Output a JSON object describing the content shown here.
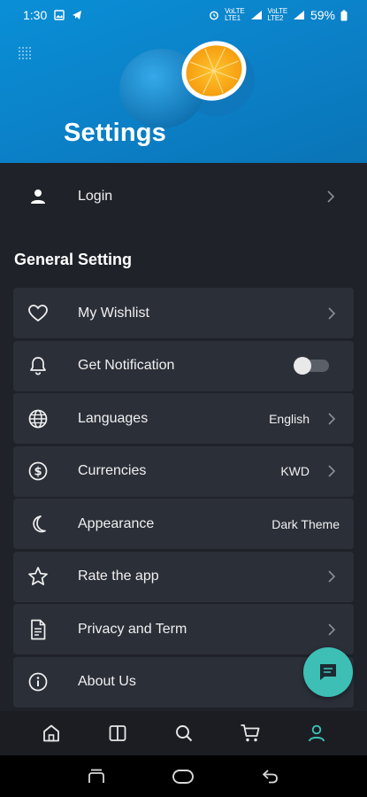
{
  "status_bar": {
    "time": "1:30",
    "battery": "59%"
  },
  "header": {
    "title": "Settings"
  },
  "login": {
    "label": "Login"
  },
  "general": {
    "title": "General Setting",
    "items": [
      {
        "label": "My Wishlist",
        "value": "",
        "icon": "heart-icon",
        "trailing": "chevron"
      },
      {
        "label": "Get Notification",
        "value": "",
        "icon": "bell-icon",
        "trailing": "toggle",
        "toggle_on": false
      },
      {
        "label": "Languages",
        "value": "English",
        "icon": "globe-icon",
        "trailing": "chevron"
      },
      {
        "label": "Currencies",
        "value": "KWD",
        "icon": "dollar-circle-icon",
        "trailing": "chevron"
      },
      {
        "label": "Appearance",
        "value": "Dark Theme",
        "icon": "moon-icon",
        "trailing": "none"
      },
      {
        "label": "Rate the app",
        "value": "",
        "icon": "star-icon",
        "trailing": "chevron"
      },
      {
        "label": "Privacy and Term",
        "value": "",
        "icon": "document-icon",
        "trailing": "chevron"
      },
      {
        "label": "About Us",
        "value": "",
        "icon": "info-icon",
        "trailing": "none"
      }
    ]
  },
  "bottom_nav": {
    "items": [
      "home-icon",
      "book-icon",
      "search-icon",
      "cart-icon",
      "profile-icon"
    ],
    "active": "profile-icon",
    "active_color": "#3dbfb5"
  },
  "colors": {
    "accent": "#3dbfb5",
    "background": "#1f2229",
    "card": "#2b2f38",
    "hero": "#0a8fd6"
  }
}
